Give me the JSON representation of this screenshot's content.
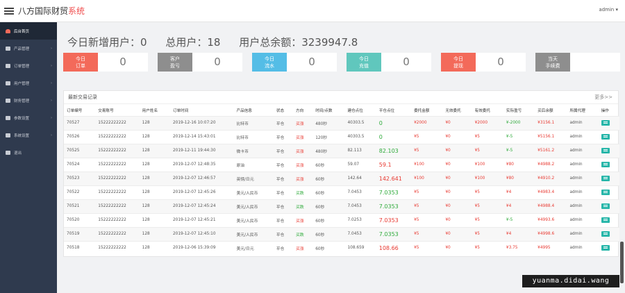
{
  "header": {
    "brand_main": "八方国际财贸",
    "brand_accent": "系统",
    "admin_label": "admin",
    "admin_caret": "▾"
  },
  "sidebar": {
    "items": [
      {
        "label": "后台首页",
        "active": true,
        "arrow": ""
      },
      {
        "label": "产品管理",
        "active": false,
        "arrow": "›"
      },
      {
        "label": "订单管理",
        "active": false,
        "arrow": "›"
      },
      {
        "label": "用户管理",
        "active": false,
        "arrow": "›"
      },
      {
        "label": "财务管理",
        "active": false,
        "arrow": "›"
      },
      {
        "label": "参数设置",
        "active": false,
        "arrow": "›"
      },
      {
        "label": "系统设置",
        "active": false,
        "arrow": "›"
      },
      {
        "label": "退出",
        "active": false,
        "arrow": ""
      }
    ]
  },
  "summary": {
    "new_users": "今日新增用户：0",
    "total_users": "总用户：18",
    "total_balance": "用户总余额：3239947.8"
  },
  "cards": [
    {
      "line1": "今日",
      "line2": "订单",
      "value": "0",
      "color": "#f36a5a"
    },
    {
      "line1": "客户",
      "line2": "盈亏",
      "value": "0",
      "color": "#8e8e8e"
    },
    {
      "line1": "今日",
      "line2": "流水",
      "value": "0",
      "color": "#54bde6"
    },
    {
      "line1": "今日",
      "line2": "充值",
      "value": "0",
      "color": "#60c7bd"
    },
    {
      "line1": "今日",
      "line2": "提现",
      "value": "0",
      "color": "#f36a5a"
    },
    {
      "line1": "当天",
      "line2": "手续费",
      "value": "",
      "color": "#8e8e8e"
    }
  ],
  "panel": {
    "title": "最新交易记录",
    "more": "更多>>"
  },
  "table": {
    "headers": [
      "订单编号",
      "交易账号",
      "用户姓名",
      "订单时间",
      "产品信息",
      "状态",
      "方向",
      "时间/点数",
      "建仓点位",
      "平仓点位",
      "委托金额",
      "无效委托",
      "有效委托",
      "实际盈亏",
      "买后余额",
      "所属代理",
      "操作"
    ],
    "rows": [
      [
        "70527",
        "15222222222",
        "128",
        "2019-12-16 10:07:20",
        "比特币",
        "平仓",
        "买涨",
        "480秒",
        "40303.5",
        "0",
        "¥2000",
        "¥0",
        "¥2000",
        "¥-2000",
        "¥3156.1",
        "admin"
      ],
      [
        "70526",
        "15222222222",
        "128",
        "2019-12-14 15:43:01",
        "比特币",
        "平仓",
        "买涨",
        "120秒",
        "40303.5",
        "0",
        "¥5",
        "¥0",
        "¥5",
        "¥-5",
        "¥5156.1",
        "admin"
      ],
      [
        "70525",
        "15222222222",
        "128",
        "2019-12-11 19:44:30",
        "微卡币",
        "平仓",
        "买涨",
        "480秒",
        "82.113",
        "82.103",
        "¥5",
        "¥0",
        "¥5",
        "¥-5",
        "¥5161.2",
        "admin"
      ],
      [
        "70524",
        "15222222222",
        "128",
        "2019-12-07 12:48:35",
        "原油",
        "平仓",
        "买涨",
        "60秒",
        "59.07",
        "59.1",
        "¥100",
        "¥0",
        "¥100",
        "¥80",
        "¥4988.2",
        "admin"
      ],
      [
        "70523",
        "15222222222",
        "128",
        "2019-12-07 12:46:57",
        "英镑/日元",
        "平仓",
        "买涨",
        "60秒",
        "142.64",
        "142.641",
        "¥100",
        "¥0",
        "¥100",
        "¥80",
        "¥4910.2",
        "admin"
      ],
      [
        "70522",
        "15222222222",
        "128",
        "2019-12-07 12:45:26",
        "美元/人民币",
        "平仓",
        "买跌",
        "60秒",
        "7.0453",
        "7.0353",
        "¥5",
        "¥0",
        "¥5",
        "¥4",
        "¥4983.4",
        "admin"
      ],
      [
        "70521",
        "15222222222",
        "128",
        "2019-12-07 12:45:24",
        "美元/人民币",
        "平仓",
        "买跌",
        "60秒",
        "7.0453",
        "7.0353",
        "¥5",
        "¥0",
        "¥5",
        "¥4",
        "¥4988.4",
        "admin"
      ],
      [
        "70520",
        "15222222222",
        "128",
        "2019-12-07 12:45:21",
        "美元/人民币",
        "平仓",
        "买涨",
        "60秒",
        "7.0253",
        "7.0353",
        "¥5",
        "¥0",
        "¥5",
        "¥-5",
        "¥4993.6",
        "admin"
      ],
      [
        "70519",
        "15222222222",
        "128",
        "2019-12-07 12:45:10",
        "美元/人民币",
        "平仓",
        "买跌",
        "60秒",
        "7.0453",
        "7.0353",
        "¥5",
        "¥0",
        "¥5",
        "¥4",
        "¥4998.6",
        "admin"
      ],
      [
        "70518",
        "15222222222",
        "128",
        "2019-12-06 15:39:09",
        "美元/日元",
        "平仓",
        "买涨",
        "60秒",
        "108.659",
        "108.66",
        "¥5",
        "¥0",
        "¥5",
        "¥3.75",
        "¥4995",
        "admin"
      ]
    ]
  },
  "watermark": "yuanma.didai.wang"
}
